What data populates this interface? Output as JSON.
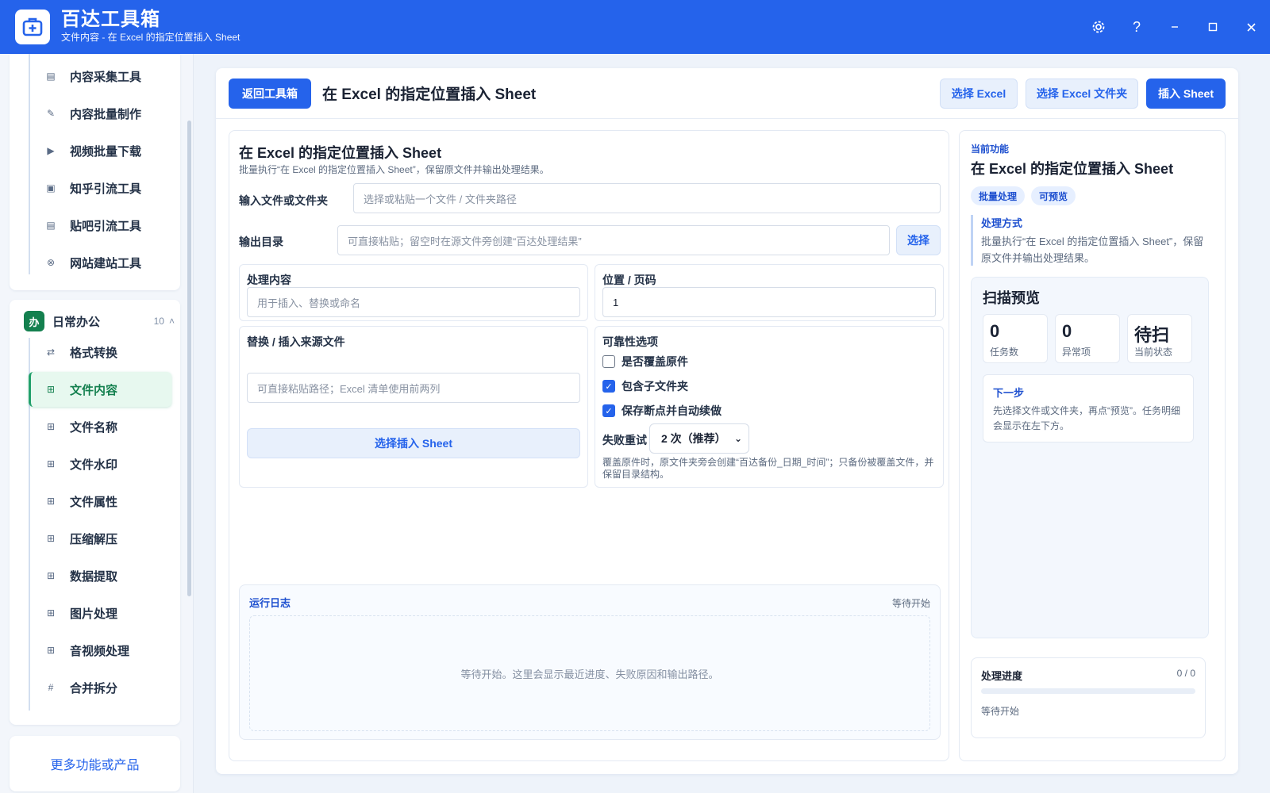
{
  "app": {
    "name": "百达工具箱",
    "subtitle": "文件内容 - 在 Excel 的指定位置插入 Sheet",
    "controls": [
      "settings-icon",
      "help-icon",
      "minimize-icon",
      "maximize-icon",
      "close-icon"
    ]
  },
  "sidebar": {
    "top_items": [
      {
        "label": "内容采集工具",
        "icon": "doc-icon"
      },
      {
        "label": "内容批量制作",
        "icon": "pen-icon"
      },
      {
        "label": "视频批量下载",
        "icon": "video-icon"
      },
      {
        "label": "知乎引流工具",
        "icon": "zhihu-icon"
      },
      {
        "label": "贴吧引流工具",
        "icon": "tieba-icon"
      },
      {
        "label": "网站建站工具",
        "icon": "site-icon"
      }
    ],
    "group": {
      "badge": "办",
      "title": "日常办公",
      "count": "10"
    },
    "group_items": [
      {
        "label": "格式转换",
        "icon": "swap-icon",
        "glyph": "⇄"
      },
      {
        "label": "文件内容",
        "icon": "grid-icon",
        "glyph": "⊞",
        "active": true
      },
      {
        "label": "文件名称",
        "icon": "grid-icon",
        "glyph": "⊞"
      },
      {
        "label": "文件水印",
        "icon": "grid-icon",
        "glyph": "⊞"
      },
      {
        "label": "文件属性",
        "icon": "grid-icon",
        "glyph": "⊞"
      },
      {
        "label": "压缩解压",
        "icon": "grid-icon",
        "glyph": "⊞"
      },
      {
        "label": "数据提取",
        "icon": "grid-icon",
        "glyph": "⊞"
      },
      {
        "label": "图片处理",
        "icon": "grid-icon",
        "glyph": "⊞"
      },
      {
        "label": "音视频处理",
        "icon": "grid-icon",
        "glyph": "⊞"
      },
      {
        "label": "合并拆分",
        "icon": "hash-icon",
        "glyph": "#"
      }
    ],
    "more": "更多功能或产品"
  },
  "toolbar": {
    "back": "返回工具箱",
    "title": "在 Excel 的指定位置插入 Sheet",
    "select_excel": "选择 Excel",
    "select_folder": "选择 Excel 文件夹",
    "run": "插入 Sheet"
  },
  "form": {
    "title": "在 Excel 的指定位置插入 Sheet",
    "desc": "批量执行“在 Excel 的指定位置插入 Sheet”，保留原文件并输出处理结果。",
    "input_label": "输入文件或文件夹",
    "input_placeholder": "选择或粘贴一个文件 / 文件夹路径",
    "output_label": "输出目录",
    "output_placeholder": "可直接粘贴；留空时在源文件旁创建“百达处理结果”",
    "output_button": "选择",
    "content_label": "处理内容",
    "content_placeholder": "用于插入、替换或命名",
    "position_label": "位置 / 页码",
    "position_value": "1",
    "source_label": "替换 / 插入来源文件",
    "source_placeholder": "可直接粘贴路径；Excel 清单使用前两列",
    "source_button": "选择插入 Sheet",
    "options_title": "可靠性选项",
    "options": [
      {
        "label": "是否覆盖原件",
        "checked": false
      },
      {
        "label": "包含子文件夹",
        "checked": true
      },
      {
        "label": "保存断点并自动续做",
        "checked": true
      }
    ],
    "retry_label": "失败重试",
    "retry_value": "2 次（推荐）",
    "hint": "覆盖原件时，原文件夹旁会创建“百达备份_日期_时间”；只备份被覆盖文件，并保留目录结构。"
  },
  "log": {
    "title": "运行日志",
    "status": "等待开始",
    "empty": "等待开始。这里会显示最近进度、失败原因和输出路径。"
  },
  "info": {
    "eyebrow": "当前功能",
    "title": "在 Excel 的指定位置插入 Sheet",
    "tags": [
      "批量处理",
      "可预览"
    ],
    "mode_title": "处理方式",
    "mode_desc": "批量执行“在 Excel 的指定位置插入 Sheet”，保留原文件并输出处理结果。",
    "scan_title": "扫描预览",
    "stats": [
      {
        "value": "0",
        "caption": "任务数"
      },
      {
        "value": "0",
        "caption": "异常项"
      },
      {
        "value": "待扫",
        "caption": "当前状态"
      }
    ],
    "next_title": "下一步",
    "next_desc": "先选择文件或文件夹，再点“预览”。任务明细会显示在左下方。",
    "progress_title": "处理进度",
    "progress_count": "0 / 0",
    "progress_fraction": 0,
    "progress_status": "等待开始"
  },
  "colors": {
    "brand": "#2563eb",
    "active_green": "#14804f",
    "active_bg": "#e7f8ef"
  }
}
